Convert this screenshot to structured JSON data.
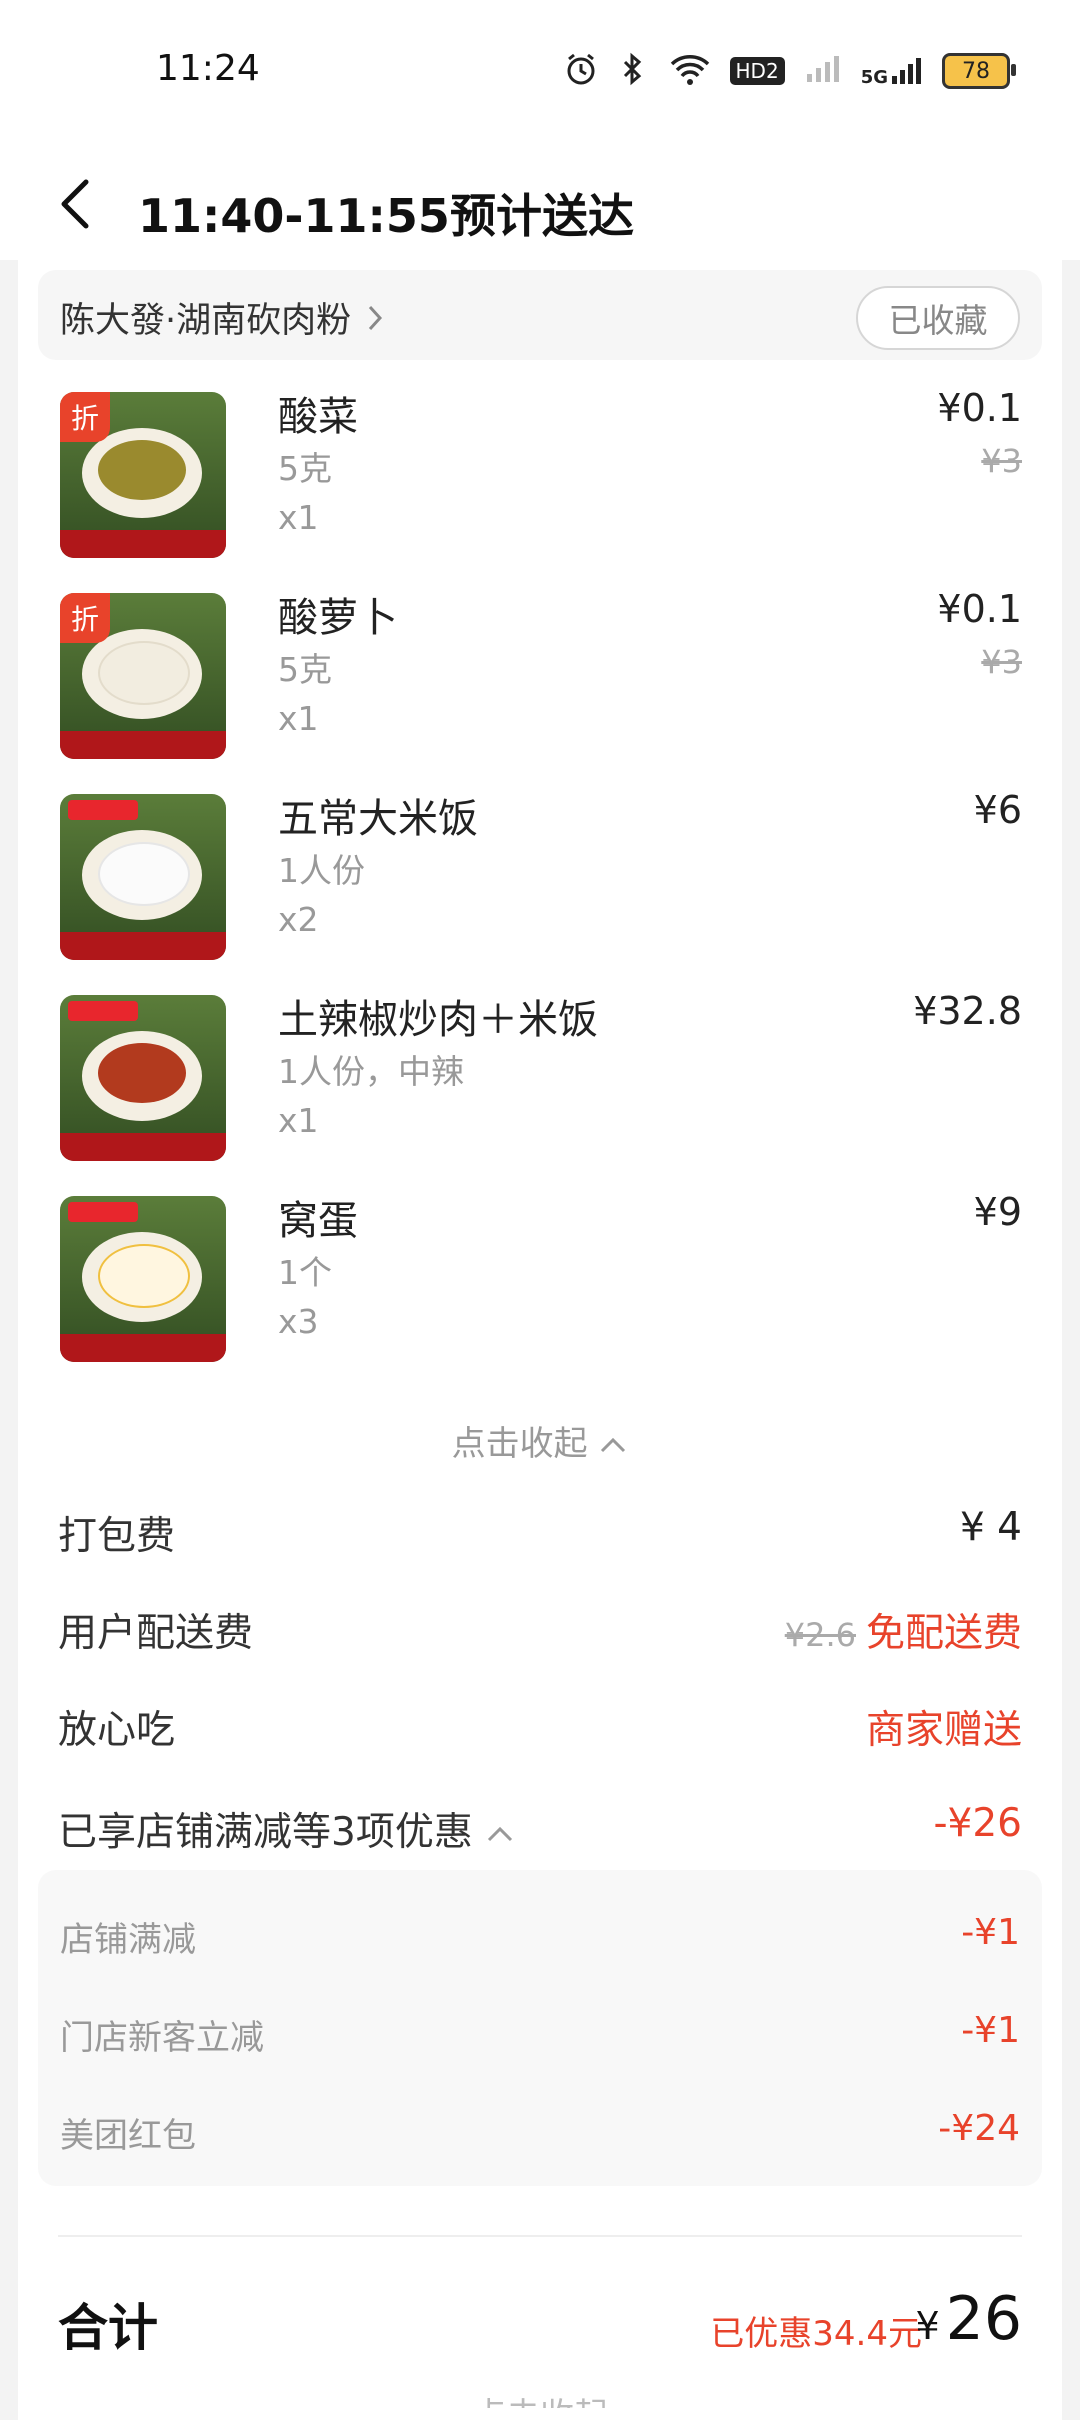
{
  "status": {
    "time": "11:24",
    "battery": "78",
    "network": "5G",
    "hd": "HD2"
  },
  "header": {
    "title": "11:40-11:55预计送达"
  },
  "store": {
    "name": "陈大發·湖南砍肉粉",
    "favorite_label": "已收藏"
  },
  "items": [
    {
      "name": "酸菜",
      "spec": "5克",
      "qty": "x1",
      "price": "¥0.1",
      "original_price": "¥3",
      "tag": "折"
    },
    {
      "name": "酸萝卜",
      "spec": "5克",
      "qty": "x1",
      "price": "¥0.1",
      "original_price": "¥3",
      "tag": "折"
    },
    {
      "name": "五常大米饭",
      "spec": "1人份",
      "qty": "x2",
      "price": "¥6"
    },
    {
      "name": "土辣椒炒肉＋米饭",
      "spec": "1人份，中辣",
      "qty": "x1",
      "price": "¥32.8"
    },
    {
      "name": "窝蛋",
      "spec": "1个",
      "qty": "x3",
      "price": "¥9"
    }
  ],
  "collapse_label": "点击收起",
  "fees": {
    "packing": {
      "label": "打包费",
      "value": "¥ 4"
    },
    "delivery": {
      "label": "用户配送费",
      "original": "¥2.6",
      "value": "免配送费"
    },
    "assurance": {
      "label": "放心吃",
      "value": "商家赠送"
    },
    "discount_summary": {
      "label": "已享店铺满减等3项优惠",
      "value": "-¥26"
    }
  },
  "discounts": [
    {
      "label": "店铺满减",
      "value": "-¥1"
    },
    {
      "label": "门店新客立减",
      "value": "-¥1"
    },
    {
      "label": "美团红包",
      "value": "-¥24"
    }
  ],
  "total": {
    "label": "合计",
    "saved": "已优惠34.4元",
    "currency": "¥",
    "amount": "26"
  },
  "footer_cutoff": "点击收起",
  "colors": {
    "accent": "#e8432b",
    "muted": "#999999",
    "text": "#222222"
  }
}
